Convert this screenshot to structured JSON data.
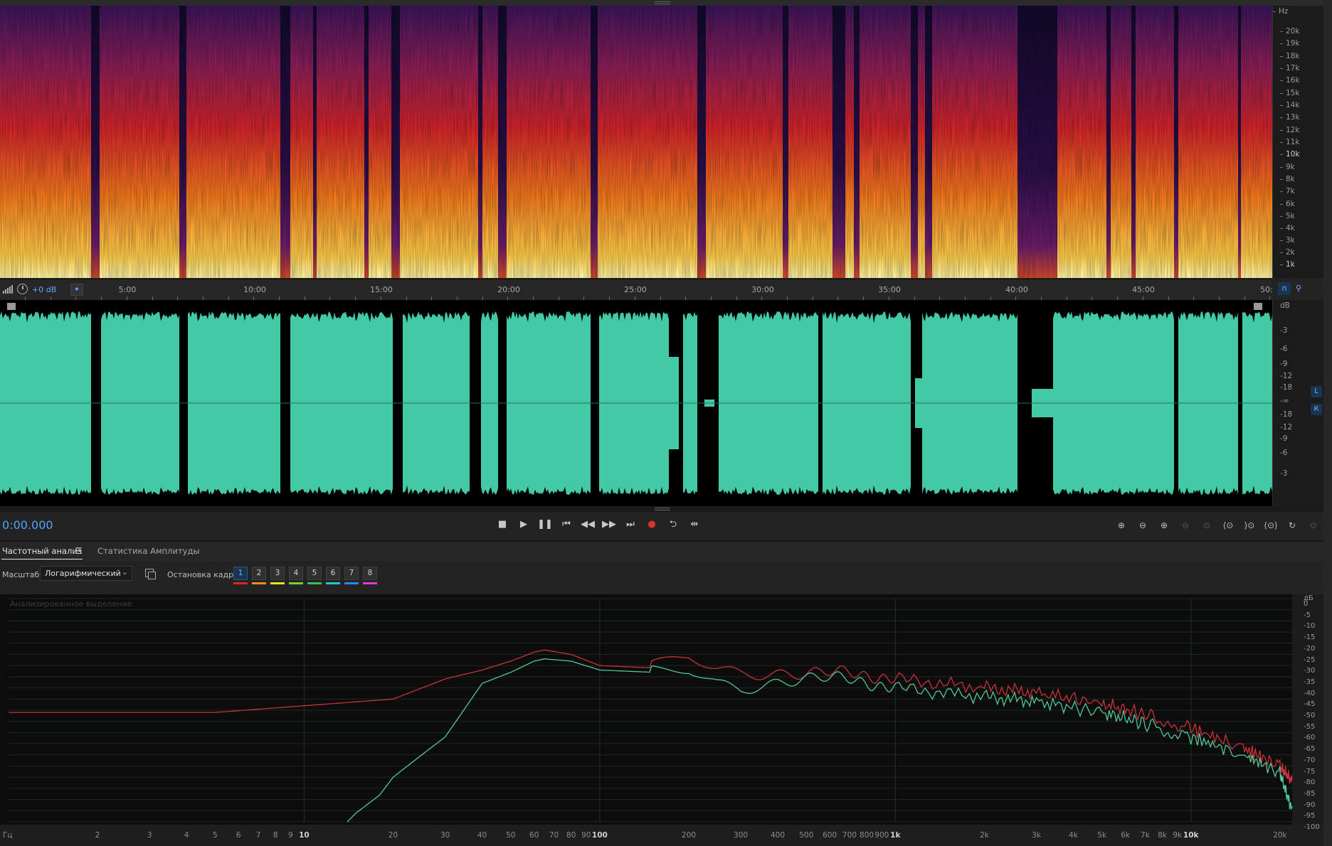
{
  "spectral": {
    "unit": "Hz",
    "ticks": [
      "20k",
      "19k",
      "18k",
      "17k",
      "16k",
      "15k",
      "14k",
      "13k",
      "12k",
      "11k",
      "10k",
      "9k",
      "8k",
      "7k",
      "6k",
      "5k",
      "4k",
      "3k",
      "2k",
      "1k"
    ]
  },
  "timeline": {
    "gain": "+0 dB",
    "ticks": [
      "5:00",
      "10:00",
      "15:00",
      "20:00",
      "25:00",
      "30:00",
      "35:00",
      "40:00",
      "45:00",
      "50:"
    ]
  },
  "waveform": {
    "unit": "dB",
    "ticks_top": [
      "-3",
      "-6",
      "-9",
      "-12",
      "-18",
      "-∞",
      "-18",
      "-12",
      "-9",
      "-6",
      "-3"
    ],
    "channel_left": "L",
    "channel_right": "К",
    "color": "#44c9a6"
  },
  "transport": {
    "timecode": "0:00.000",
    "record_color": "#e0302a",
    "accent": "#4ea3ff"
  },
  "panel": {
    "tabs": [
      "Частотный анализ",
      "Статистика Амплитуды"
    ],
    "menu_glyph": "☰",
    "scale_label": "Масштаб:",
    "scale_value": "Логарифмический",
    "freeze_label": "Остановка кадра:",
    "freeze_buttons": [
      "1",
      "2",
      "3",
      "4",
      "5",
      "6",
      "7",
      "8"
    ],
    "freeze_colors": [
      "#e02222",
      "#f08a1c",
      "#f0e020",
      "#7ad02a",
      "#34c058",
      "#22c6d8",
      "#2a88e8",
      "#e43ad8"
    ],
    "plot_caption": "Анализированное выделение"
  },
  "chart_data": {
    "type": "line",
    "xlabel": "Гц",
    "ylabel": "дБ",
    "x_scale": "log",
    "x_ticks": [
      "2",
      "3",
      "4",
      "5",
      "6",
      "7",
      "8",
      "9",
      "10",
      "20",
      "30",
      "40",
      "50",
      "60",
      "70",
      "80",
      "90",
      "100",
      "200",
      "300",
      "400",
      "500",
      "600",
      "700",
      "800",
      "900",
      "1k",
      "2k",
      "3k",
      "4k",
      "5k",
      "6k",
      "7k",
      "8k",
      "9k",
      "10k",
      "20k"
    ],
    "y_ticks": [
      "0",
      "-5",
      "-10",
      "-15",
      "-20",
      "-25",
      "-30",
      "-35",
      "-40",
      "-45",
      "-50",
      "-55",
      "-60",
      "-65",
      "-70",
      "-75",
      "-80",
      "-85",
      "-90",
      "-95",
      "-100"
    ],
    "ylim": [
      -100,
      0
    ],
    "xlim": [
      1,
      22000
    ],
    "grid": true,
    "series": [
      {
        "color": "#c8323a",
        "x": [
          1,
          5,
          10,
          20,
          30,
          40,
          50,
          60,
          65,
          80,
          100,
          150,
          200,
          250,
          300,
          400,
          500,
          700,
          1000,
          2000,
          3000,
          5000,
          7000,
          10000,
          15000,
          20000,
          22000
        ],
        "y": [
          -51,
          -51,
          -48,
          -45,
          -36,
          -32,
          -28,
          -24,
          -23,
          -25,
          -30,
          -31,
          -26,
          -31,
          -33,
          -33,
          -34,
          -33,
          -36,
          -40,
          -42,
          -47,
          -52,
          -58,
          -67,
          -75,
          -82
        ]
      },
      {
        "color": "#52c89a",
        "x": [
          14,
          15,
          18,
          20,
          25,
          30,
          40,
          50,
          60,
          65,
          80,
          100,
          150,
          200,
          250,
          300,
          400,
          500,
          700,
          1000,
          2000,
          3000,
          5000,
          7000,
          10000,
          15000,
          20000,
          22000
        ],
        "y": [
          -100,
          -96,
          -88,
          -80,
          -70,
          -62,
          -38,
          -33,
          -28,
          -27,
          -28,
          -32,
          -33,
          -32,
          -38,
          -40,
          -37,
          -36,
          -36,
          -40,
          -44,
          -46,
          -51,
          -56,
          -62,
          -70,
          -78,
          -95
        ]
      }
    ]
  }
}
